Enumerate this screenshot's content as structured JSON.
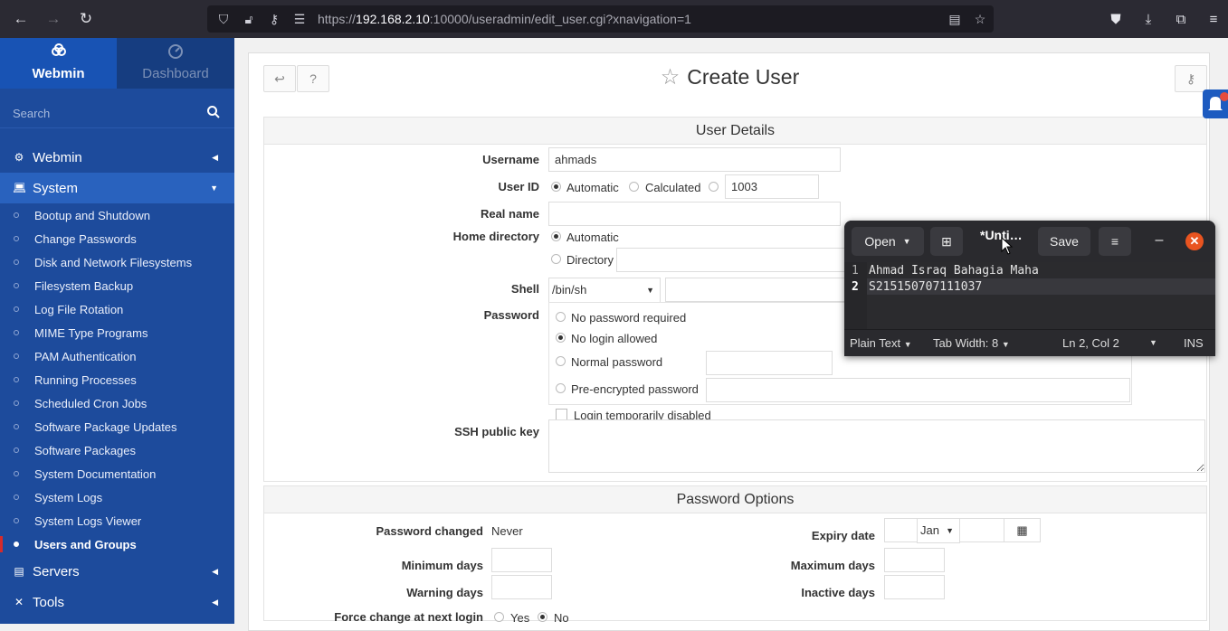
{
  "browser": {
    "url_prefix": "https://",
    "url_host": "192.168.2.10",
    "url_rest": ":10000/useradmin/edit_user.cgi?xnavigation=1"
  },
  "sidebar": {
    "tab_webmin": "Webmin",
    "tab_dashboard": "Dashboard",
    "search_placeholder": "Search",
    "categories": [
      {
        "label": "Webmin",
        "icon": "gear-icon"
      },
      {
        "label": "System",
        "icon": "laptop-icon"
      },
      {
        "label": "Servers",
        "icon": "server-icon"
      },
      {
        "label": "Tools",
        "icon": "wrench-icon"
      }
    ],
    "system_items": [
      "Bootup and Shutdown",
      "Change Passwords",
      "Disk and Network Filesystems",
      "Filesystem Backup",
      "Log File Rotation",
      "MIME Type Programs",
      "PAM Authentication",
      "Running Processes",
      "Scheduled Cron Jobs",
      "Software Package Updates",
      "Software Packages",
      "System Documentation",
      "System Logs",
      "System Logs Viewer",
      "Users and Groups"
    ],
    "active_item": "Users and Groups"
  },
  "page": {
    "title": "Create User",
    "user_details": {
      "heading": "User Details",
      "username_label": "Username",
      "username_value": "ahmads",
      "userid_label": "User ID",
      "userid_opt_automatic": "Automatic",
      "userid_opt_calculated": "Calculated",
      "userid_value": "1003",
      "realname_label": "Real name",
      "homedir_label": "Home directory",
      "homedir_opt_automatic": "Automatic",
      "homedir_opt_directory": "Directory",
      "shell_label": "Shell",
      "shell_value": "/bin/sh",
      "password_label": "Password",
      "pw_opt_none": "No password required",
      "pw_opt_nologin": "No login allowed",
      "pw_opt_normal": "Normal password",
      "pw_opt_preenc": "Pre-encrypted password",
      "login_disabled": "Login temporarily disabled",
      "ssh_label": "SSH public key"
    },
    "password_options": {
      "heading": "Password Options",
      "changed_label": "Password changed",
      "changed_value": "Never",
      "expiry_label": "Expiry date",
      "expiry_month": "Jan",
      "min_days_label": "Minimum days",
      "max_days_label": "Maximum days",
      "warn_days_label": "Warning days",
      "inactive_label": "Inactive days",
      "force_label": "Force change at next login",
      "force_yes": "Yes",
      "force_no": "No"
    }
  },
  "editor": {
    "open_label": "Open",
    "title": "*Unti…",
    "save_label": "Save",
    "lines": [
      {
        "num": "1",
        "text": "Ahmad Israq Bahagia Maha"
      },
      {
        "num": "2",
        "text": "S215150707111037"
      }
    ],
    "status_lang": "Plain Text",
    "status_tab": "Tab Width: 8",
    "status_pos": "Ln 2, Col 2",
    "status_mode": "INS"
  }
}
